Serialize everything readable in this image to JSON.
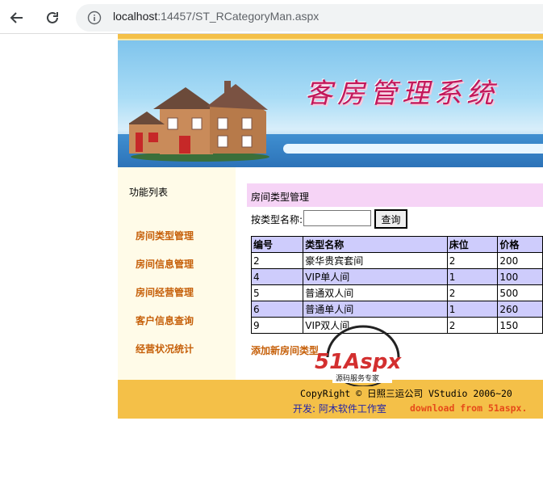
{
  "browser": {
    "url_host": "localhost",
    "url_rest": ":14457/ST_RCategoryMan.aspx"
  },
  "banner": {
    "title": "客房管理系统"
  },
  "sidebar": {
    "title": "功能列表",
    "items": [
      {
        "label": "房间类型管理"
      },
      {
        "label": "房间信息管理"
      },
      {
        "label": "房间经营管理"
      },
      {
        "label": "客户信息查询"
      },
      {
        "label": "经营状况统计"
      }
    ]
  },
  "main": {
    "section_title": "房间类型管理",
    "search": {
      "label": "按类型名称:",
      "value": "",
      "button": "查询"
    },
    "table": {
      "headers": [
        "编号",
        "类型名称",
        "床位",
        "价格"
      ],
      "rows": [
        [
          "2",
          "豪华贵宾套间",
          "2",
          "200"
        ],
        [
          "4",
          "VIP单人间",
          "1",
          "100"
        ],
        [
          "5",
          "普通双人间",
          "2",
          "500"
        ],
        [
          "6",
          "普通单人间",
          "1",
          "260"
        ],
        [
          "9",
          "VIP双人间",
          "2",
          "150"
        ]
      ]
    },
    "add_link": "添加新房间类型"
  },
  "footer": {
    "copyright": "CopyRight © 日照三运公司 VStudio 2006~20",
    "developer": "开发: 阿木软件工作室",
    "download": "download from 51aspx."
  },
  "watermark": {
    "brand": "51Aspx",
    "tagline": "源码服务专家"
  },
  "colors": {
    "accent": "#f4c048",
    "menu_link": "#c6600a",
    "table_highlight": "#ceccfc",
    "section_bg": "#f6d4f6"
  }
}
